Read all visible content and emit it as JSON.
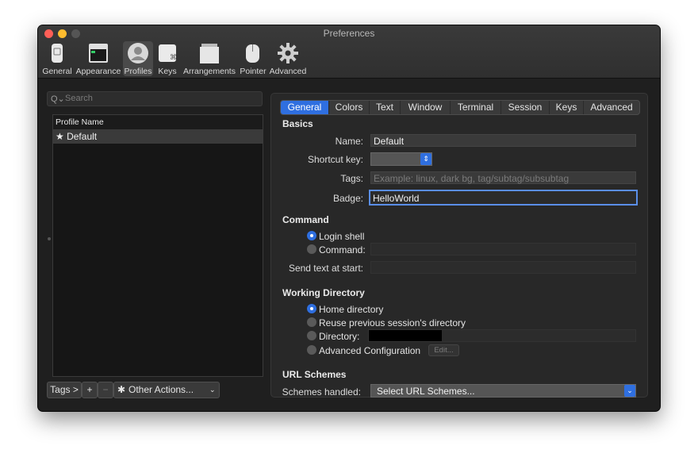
{
  "window": {
    "title": "Preferences"
  },
  "toolbar": [
    {
      "label": "General",
      "icon": "phone-switch-icon"
    },
    {
      "label": "Appearance",
      "icon": "appearance-window-icon"
    },
    {
      "label": "Profiles",
      "icon": "profile-person-icon"
    },
    {
      "label": "Keys",
      "icon": "command-key-icon"
    },
    {
      "label": "Arrangements",
      "icon": "window-stack-icon"
    },
    {
      "label": "Pointer",
      "icon": "mouse-icon"
    },
    {
      "label": "Advanced",
      "icon": "gear-icon"
    }
  ],
  "sidebar": {
    "search_placeholder": "Search",
    "list_header": "Profile Name",
    "profiles": [
      "★ Default"
    ],
    "tags_button": "Tags >",
    "add_button": "+",
    "remove_button": "−",
    "other_actions": "Other Actions..."
  },
  "tabs": [
    "General",
    "Colors",
    "Text",
    "Window",
    "Terminal",
    "Session",
    "Keys",
    "Advanced"
  ],
  "basics": {
    "title": "Basics",
    "name_label": "Name:",
    "name_value": "Default",
    "shortcut_label": "Shortcut key:",
    "tags_label": "Tags:",
    "tags_placeholder": "Example: linux, dark bg, tag/subtag/subsubtag",
    "badge_label": "Badge:",
    "badge_value": "HelloWorld"
  },
  "command": {
    "title": "Command",
    "login_shell": "Login shell",
    "command_label": "Command:",
    "send_text_label": "Send text at start:"
  },
  "working_directory": {
    "title": "Working Directory",
    "home": "Home directory",
    "reuse": "Reuse previous session's directory",
    "directory": "Directory:",
    "advanced": "Advanced Configuration",
    "edit": "Edit..."
  },
  "url_schemes": {
    "title": "URL Schemes",
    "label": "Schemes handled:",
    "select": "Select URL Schemes..."
  },
  "colors": {
    "accent": "#2f6fe0",
    "close": "#ff5f57",
    "minimize": "#febc2e",
    "zoom_disabled": "#555555"
  }
}
